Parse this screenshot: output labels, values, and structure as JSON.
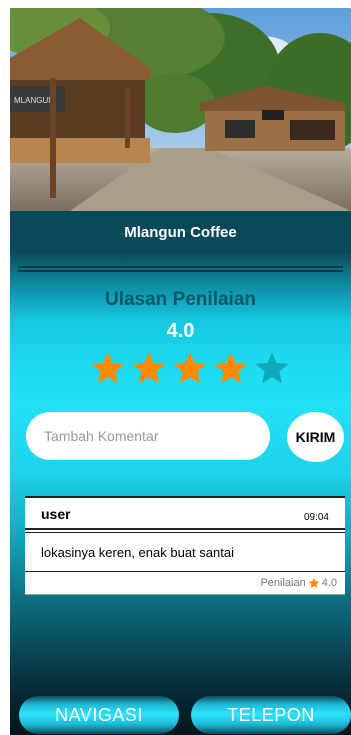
{
  "place": {
    "name": "Mlangun Coffee",
    "sign_text": "MLANGUN"
  },
  "review": {
    "heading": "Ulasan Penilaian",
    "rating": "4.0",
    "stars_filled": 4,
    "stars_total": 5,
    "star_color": "#ff8a00",
    "star_empty_color": "#12a9bd"
  },
  "comment_form": {
    "placeholder": "Tambah Komentar",
    "value": "",
    "send_label": "KIRIM"
  },
  "comments": [
    {
      "user": "user",
      "time": "09:04",
      "text": "lokasinya keren, enak buat santai",
      "rating_label": "Penilaian",
      "rating": "4.0"
    }
  ],
  "bottom_nav": {
    "navigate_label": "NAVIGASI",
    "call_label": "TELEPON"
  },
  "colors": {
    "title_bar": "#0a4a58",
    "heading": "#0b5866",
    "accent_cyan": "#23e0f6"
  }
}
